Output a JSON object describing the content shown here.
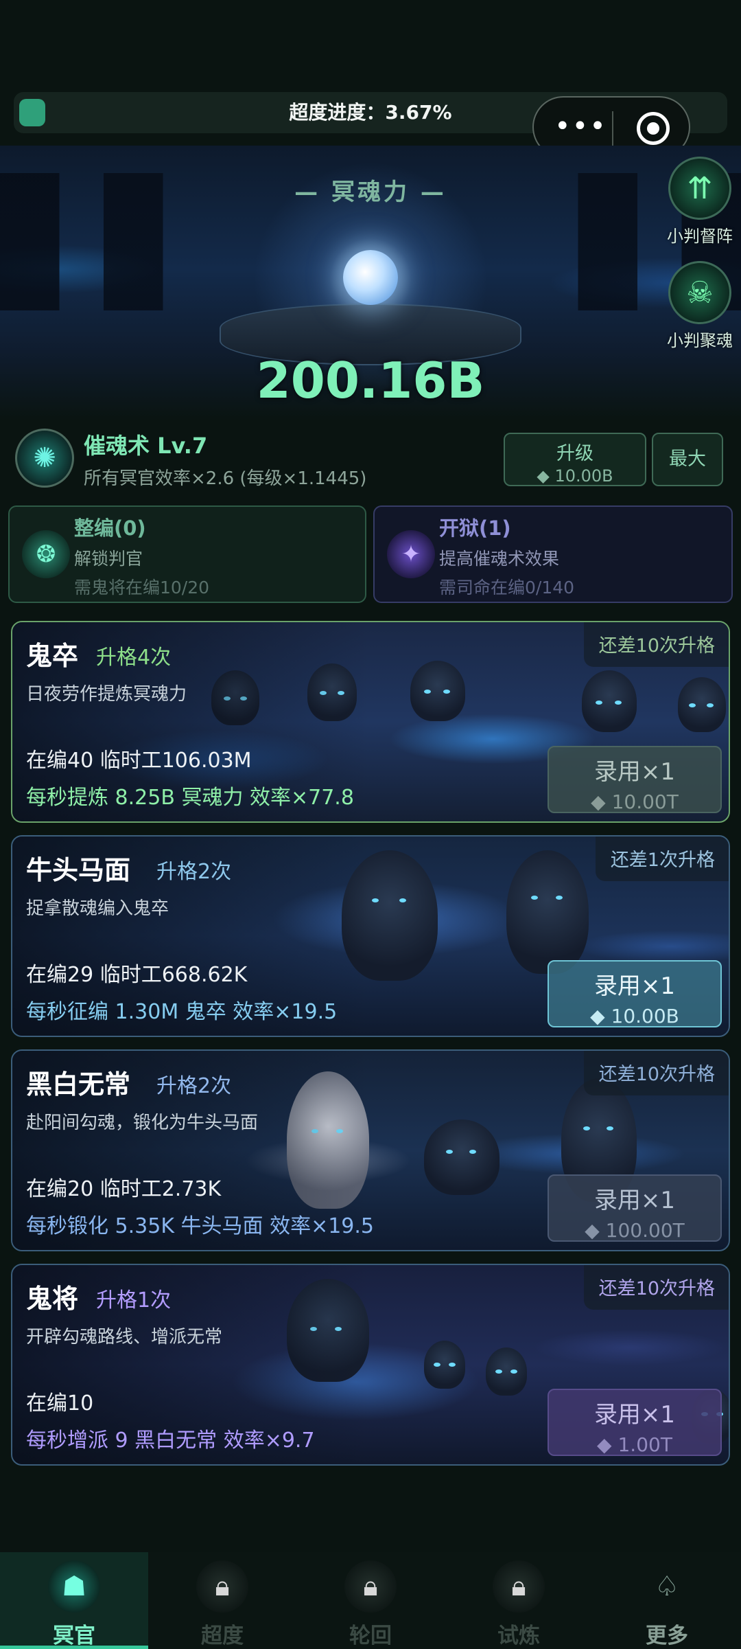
{
  "progress": {
    "label": "超度进度：3.67%",
    "percent": 3.67
  },
  "capsule": {
    "menu_icon": "more-dots-icon",
    "close_icon": "record-icon"
  },
  "hero": {
    "title": "— 冥魂力 —",
    "value": "200.16B",
    "side_buttons": [
      {
        "label": "小判督阵",
        "icon": "arrows-up-icon"
      },
      {
        "label": "小判聚魂",
        "icon": "skull-icon"
      }
    ]
  },
  "skill": {
    "name": "催魂术 Lv.7",
    "desc": "所有冥官效率×2.6 (每级×1.1445)",
    "upgrade_label": "升级",
    "upgrade_cost": "◆ 10.00B",
    "max_label": "最大"
  },
  "panels": {
    "left": {
      "title": "整编(0)",
      "line1": "解锁判官",
      "line2": "需鬼将在编10/20"
    },
    "right": {
      "title": "开狱(1)",
      "line1": "提高催魂术效果",
      "line2": "需司命在编0/140"
    }
  },
  "units": [
    {
      "name": "鬼卒",
      "rank": "升格4次",
      "need": "还差10次升格",
      "desc": "日夜劳作提炼冥魂力",
      "stat1": "在编40  临时工106.03M",
      "stat2": "每秒提炼 8.25B 冥魂力  效率×77.8",
      "hire_label": "录用×1",
      "hire_cost": "◆ 10.00T"
    },
    {
      "name": "牛头马面",
      "rank": "升格2次",
      "need": "还差1次升格",
      "desc": "捉拿散魂编入鬼卒",
      "stat1": "在编29  临时工668.62K",
      "stat2": "每秒征编 1.30M 鬼卒  效率×19.5",
      "hire_label": "录用×1",
      "hire_cost": "◆ 10.00B"
    },
    {
      "name": "黑白无常",
      "rank": "升格2次",
      "need": "还差10次升格",
      "desc": "赴阳间勾魂，锻化为牛头马面",
      "stat1": "在编20  临时工2.73K",
      "stat2": "每秒锻化 5.35K 牛头马面  效率×19.5",
      "hire_label": "录用×1",
      "hire_cost": "◆ 100.00T"
    },
    {
      "name": "鬼将",
      "rank": "升格1次",
      "need": "还差10次升格",
      "desc": "开辟勾魂路线、增派无常",
      "stat1": "在编10",
      "stat2": "每秒增派 9 黑白无常  效率×9.7",
      "hire_label": "录用×1",
      "hire_cost": "◆ 1.00T"
    }
  ],
  "nav": [
    {
      "label": "冥官",
      "icon": "ghost-mask-icon",
      "state": "active"
    },
    {
      "label": "超度",
      "icon": "lock-icon",
      "state": "locked"
    },
    {
      "label": "轮回",
      "icon": "lock-icon",
      "state": "locked"
    },
    {
      "label": "试炼",
      "icon": "lock-icon",
      "state": "locked"
    },
    {
      "label": "更多",
      "icon": "spade-icon",
      "state": "normal"
    }
  ]
}
